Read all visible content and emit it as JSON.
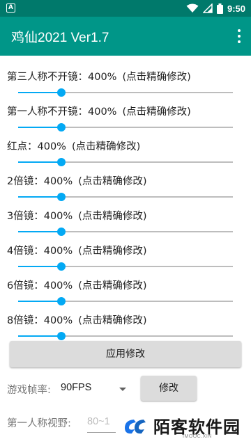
{
  "status_bar": {
    "left_icon_glyph": "A",
    "icons": [
      "wifi-icon",
      "signal-icon",
      "battery-icon"
    ],
    "time": "9:50"
  },
  "app_bar": {
    "title": "鸡仙2021 Ver1.7",
    "overflow_icon": "more-vert-icon"
  },
  "settings": [
    {
      "name": "第三人称不开镜",
      "value": "400%",
      "hint": "(点击精确修改)",
      "level": 0.2
    },
    {
      "name": "第一人称不开镜",
      "value": "400%",
      "hint": "(点击精确修改)",
      "level": 0.2
    },
    {
      "name": "红点",
      "value": "400%",
      "hint": "(点击精确修改)",
      "level": 0.2
    },
    {
      "name": "2倍镜",
      "value": "400%",
      "hint": "(点击精确修改)",
      "level": 0.2
    },
    {
      "name": "3倍镜",
      "value": "400%",
      "hint": "(点击精确修改)",
      "level": 0.2
    },
    {
      "name": "4倍镜",
      "value": "400%",
      "hint": "(点击精确修改)",
      "level": 0.2
    },
    {
      "name": "6倍镜",
      "value": "400%",
      "hint": "(点击精确修改)",
      "level": 0.2
    },
    {
      "name": "8倍镜",
      "value": "400%",
      "hint": "(点击精确修改)",
      "level": 0.2
    }
  ],
  "separator": "：",
  "apply_button": "应用修改",
  "fps": {
    "label": "游戏帧率:",
    "value": "90FPS",
    "button": "修改"
  },
  "fov": {
    "label": "第一人称视野:",
    "placeholder": "80~1"
  },
  "watermark": {
    "text": "陌客软件园",
    "sub": "IMOOC.XIN"
  },
  "colors": {
    "status_bar": "#00796B",
    "app_bar": "#009688",
    "slider_accent": "#03A9F4"
  }
}
